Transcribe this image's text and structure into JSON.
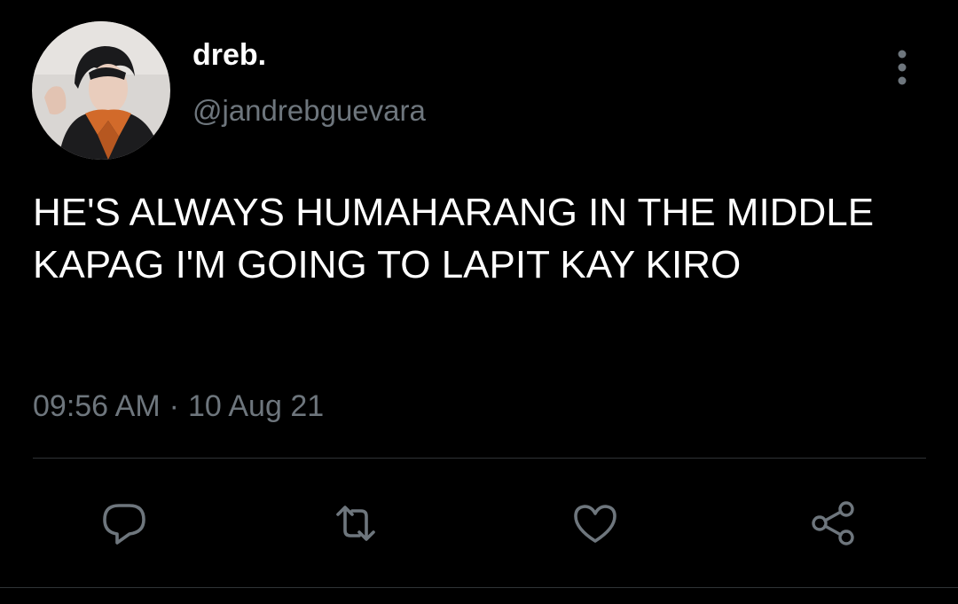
{
  "author": {
    "display_name": "dreb.",
    "handle": "@jandrebguevara"
  },
  "tweet": {
    "text": "HE'S ALWAYS HUMAHARANG IN THE MIDDLE KAPAG I'M GOING TO LAPIT KAY KIRO",
    "time": "09:56 AM",
    "separator": "·",
    "date": "10 Aug 21"
  },
  "icons": {
    "more": "more-vertical-icon",
    "reply": "reply-icon",
    "retweet": "retweet-icon",
    "like": "heart-icon",
    "share": "share-icon"
  },
  "colors": {
    "background": "#000000",
    "primary_text": "#ffffff",
    "secondary_text": "#6e767d",
    "divider": "#2f3336"
  }
}
